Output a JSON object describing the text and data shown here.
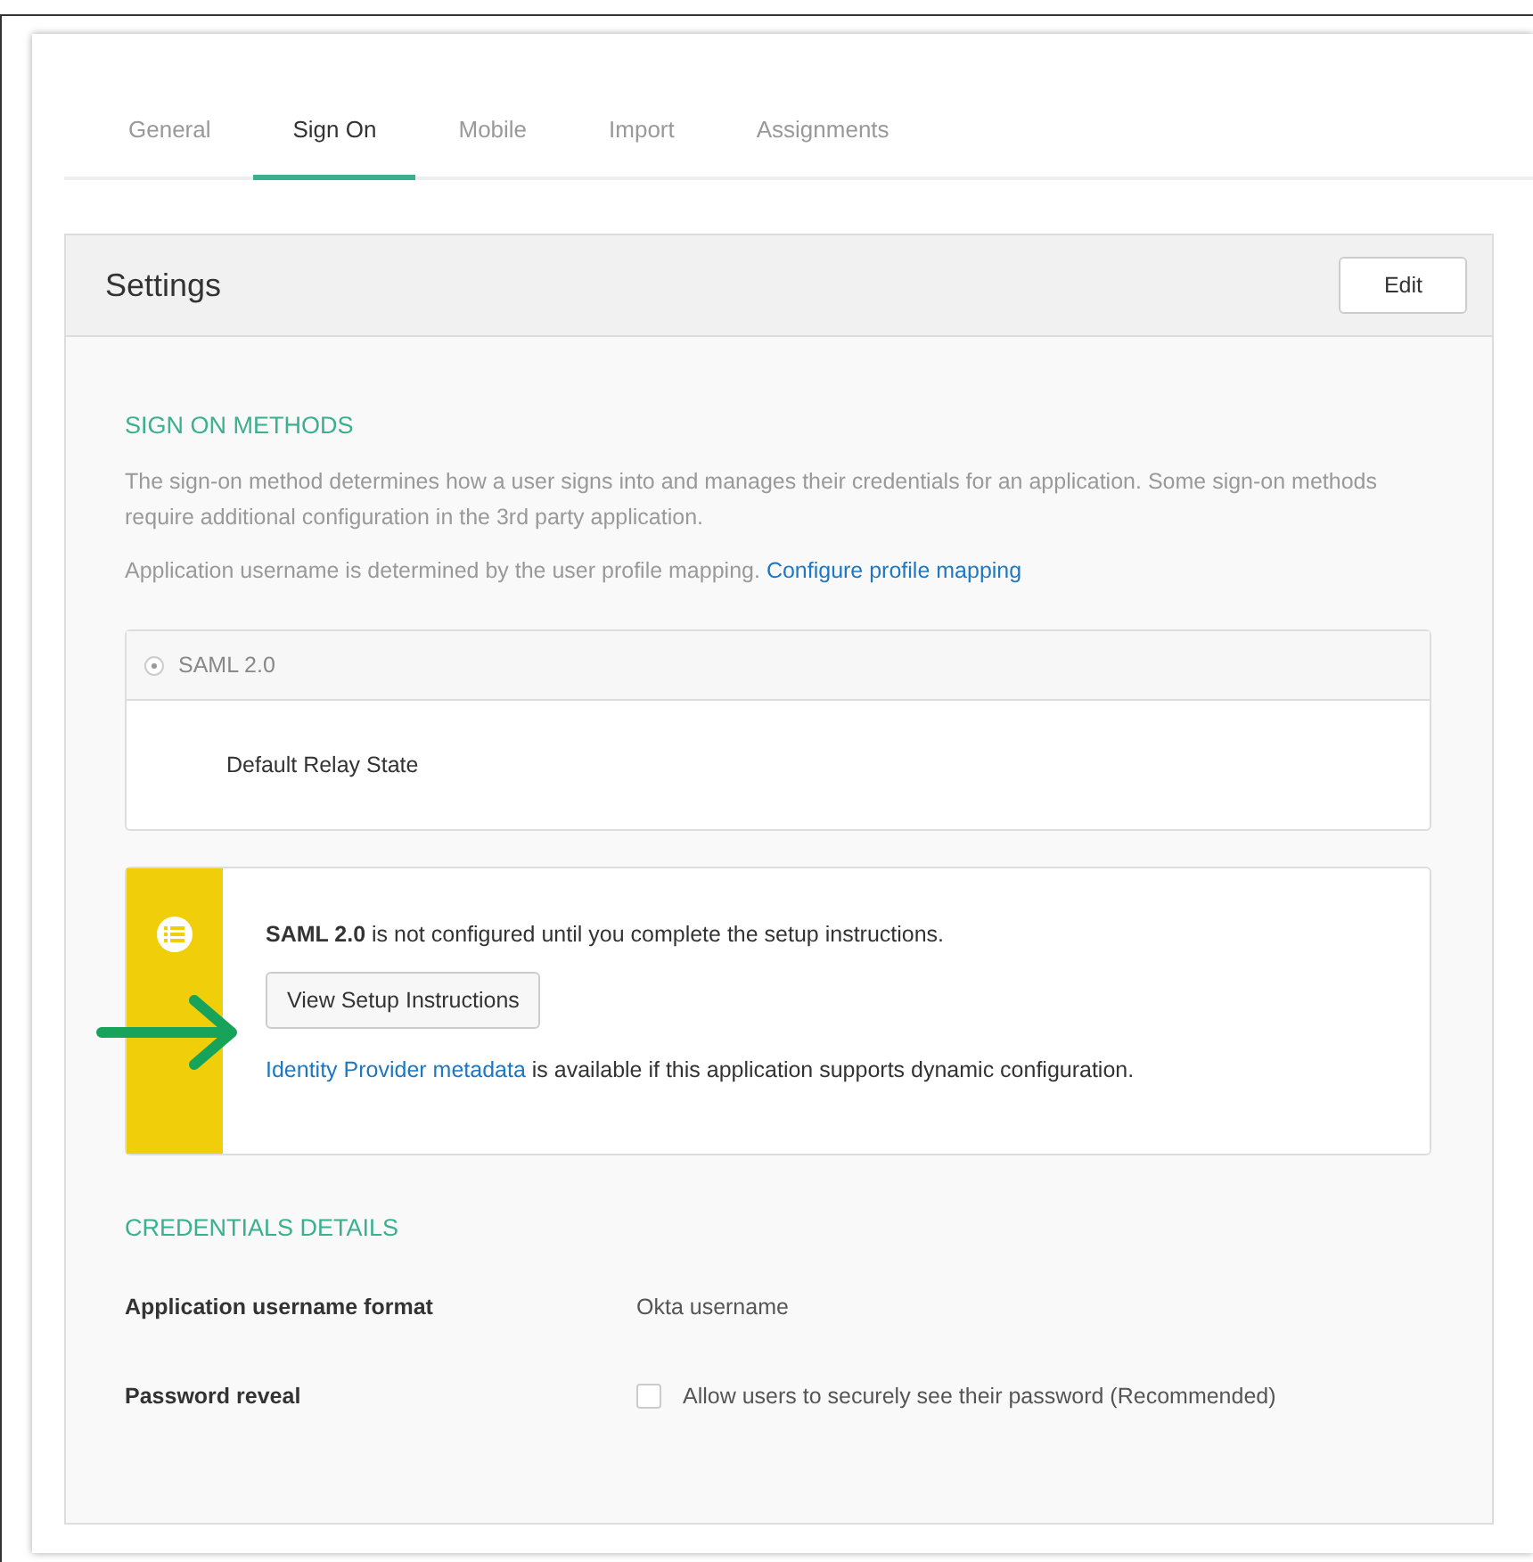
{
  "tabs": [
    {
      "label": "General",
      "selected": false
    },
    {
      "label": "Sign On",
      "selected": true
    },
    {
      "label": "Mobile",
      "selected": false
    },
    {
      "label": "Import",
      "selected": false
    },
    {
      "label": "Assignments",
      "selected": false
    }
  ],
  "settings": {
    "title": "Settings",
    "edit_button": "Edit",
    "sign_on_methods": {
      "heading": "SIGN ON METHODS",
      "description": "The sign-on method determines how a user signs into and manages their credentials for an application. Some sign-on methods require additional configuration in the 3rd party application.",
      "mapping_text": "Application username is determined by the user profile mapping.",
      "mapping_link": "Configure profile mapping",
      "method": {
        "label": "SAML 2.0",
        "selected": true,
        "field_label": "Default Relay State"
      }
    },
    "notice": {
      "message": "**SAML 2.0** is not configured until you complete the setup instructions.",
      "button": "View Setup Instructions",
      "link": "Identity Provider metadata",
      "link_suffix": "is available if this application supports dynamic configuration."
    },
    "credentials": {
      "heading": "CREDENTIALS DETAILS",
      "rows": [
        {
          "kind": "text",
          "label": "Application username format",
          "value": "Okta username"
        },
        {
          "kind": "checkbox",
          "label": "Password reveal",
          "value": "Allow users to securely see their password (Recommended)",
          "checked": false
        }
      ]
    }
  }
}
